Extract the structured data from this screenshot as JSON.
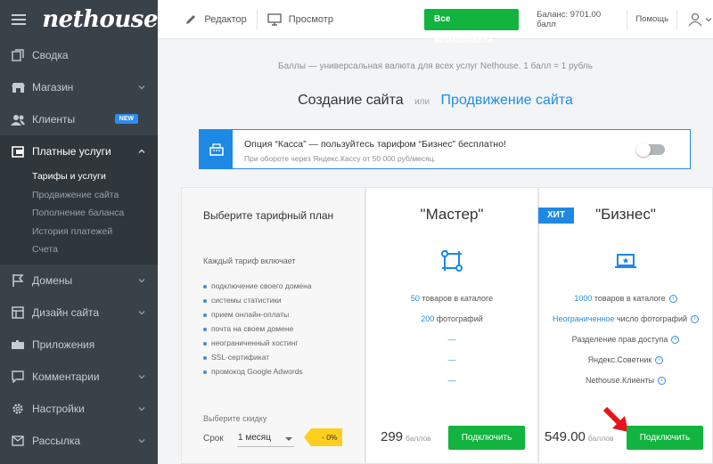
{
  "brand": {
    "logo": "nethouse"
  },
  "sidebar": {
    "items": [
      {
        "label": "Сводка",
        "icon": "copy-icon",
        "chevron": false
      },
      {
        "label": "Магазин",
        "icon": "shop-icon",
        "chevron": true
      },
      {
        "label": "Клиенты",
        "icon": "users-icon",
        "chevron": false,
        "badge": "NEW"
      },
      {
        "label": "Платные услуги",
        "icon": "wallet-icon",
        "chevron": true,
        "active": true
      }
    ],
    "subitems": [
      "Тарифы и услуги",
      "Продвижение сайта",
      "Пополнение баланса",
      "История платежей",
      "Счета"
    ],
    "items_after": [
      {
        "label": "Домены",
        "icon": "flag-icon",
        "chevron": true
      },
      {
        "label": "Дизайн сайта",
        "icon": "layout-icon",
        "chevron": true
      },
      {
        "label": "Приложения",
        "icon": "puzzle-icon",
        "chevron": false
      },
      {
        "label": "Комментарии",
        "icon": "comment-icon",
        "chevron": true
      },
      {
        "label": "Настройки",
        "icon": "gear-icon",
        "chevron": true
      },
      {
        "label": "Рассылка",
        "icon": "mail-icon",
        "chevron": true
      }
    ]
  },
  "topbar": {
    "editor": "Редактор",
    "preview": "Просмотр",
    "all_features": "Все возможности",
    "balance": "Баланс: 9701.00 балл",
    "help": "Помощь"
  },
  "main": {
    "notice": "Баллы — универсальная валюта для всех услуг Nethouse. 1 балл = 1 рубль",
    "switch": {
      "create": "Создание сайта",
      "or": "или",
      "promo": "Продвижение сайта"
    },
    "kassa": {
      "title": "Опция “Касса” — пользуйтесь тарифом “Бизнес” бесплатно!",
      "subtitle": "При обороте через Яндекс.Кассу от 50 000 руб/месяц.",
      "enabled": false
    },
    "info": {
      "title": "Выберите тарифный план",
      "each_includes": "Каждый тариф включает",
      "features": [
        "подключение своего домена",
        "системы статистики",
        "прием онлайн-оплаты",
        "почта на своем домене",
        "неограниченный хостинг",
        "SSL-сертификат",
        "промокод Google Adwords"
      ],
      "discount_label": "Выберите скидку",
      "term_label": "Срок",
      "term_value": "1 месяц",
      "discount_tag": "- 0%"
    },
    "master": {
      "name": "\"Мастер\"",
      "icon": "pencil-frame-icon",
      "products_num": "50",
      "products_text": "товаров в каталоге",
      "photos_num": "200",
      "photos_text": "фотографий",
      "dash1": "—",
      "dash2": "—",
      "dash3": "—",
      "price": "299",
      "currency": "баллов",
      "connect": "Подключить"
    },
    "business": {
      "hit": "ХИТ",
      "name": "\"Бизнес\"",
      "icon": "laptop-star-icon",
      "products_num": "1000",
      "products_text": "товаров в каталоге",
      "photos_num": "Неограниченное",
      "photos_text": "число фотографий",
      "access": "Разделение прав доступа",
      "advisor": "Яндекс.Советник",
      "clients": "Nethouse.Клиенты",
      "price": "549.00",
      "currency": "баллов",
      "connect": "Подключить"
    }
  }
}
